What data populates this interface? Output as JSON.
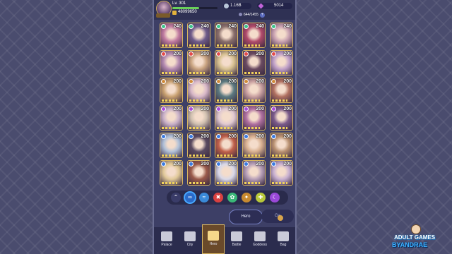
{
  "player": {
    "level": "Lv. 301",
    "power": "48099650",
    "coins": "1.16B",
    "gems": "5014",
    "hero_count": "644/1455"
  },
  "heroes": [
    {
      "level": "240",
      "element": "#3cc38a",
      "tint": "#c07aa0"
    },
    {
      "level": "240",
      "element": "#3cc38a",
      "tint": "#6e5b8a"
    },
    {
      "level": "240",
      "element": "#3cc38a",
      "tint": "#8a6f6b"
    },
    {
      "level": "240",
      "element": "#3cc38a",
      "tint": "#b04a6a"
    },
    {
      "level": "240",
      "element": "#3cc38a",
      "tint": "#c8a0b0"
    },
    {
      "level": "200",
      "element": "#e24a4a",
      "tint": "#b48ab0"
    },
    {
      "level": "200",
      "element": "#e24a4a",
      "tint": "#c9a380"
    },
    {
      "level": "200",
      "element": "#e24a4a",
      "tint": "#d6c090"
    },
    {
      "level": "200",
      "element": "#e24a4a",
      "tint": "#6a4a60"
    },
    {
      "level": "200",
      "element": "#e24a4a",
      "tint": "#c0a0c8"
    },
    {
      "level": "200",
      "element": "#d08a3a",
      "tint": "#c8a070"
    },
    {
      "level": "200",
      "element": "#d08a3a",
      "tint": "#d8b8c8"
    },
    {
      "level": "200",
      "element": "#d08a3a",
      "tint": "#5c7a80"
    },
    {
      "level": "200",
      "element": "#d08a3a",
      "tint": "#c9a0a0"
    },
    {
      "level": "200",
      "element": "#d08a3a",
      "tint": "#b07060"
    },
    {
      "level": "200",
      "element": "#a84ad8",
      "tint": "#c8b0c8"
    },
    {
      "level": "200",
      "element": "#a84ad8",
      "tint": "#d0c0b0"
    },
    {
      "level": "200",
      "element": "#a84ad8",
      "tint": "#e0c8d0"
    },
    {
      "level": "200",
      "element": "#a84ad8",
      "tint": "#b070a0"
    },
    {
      "level": "200",
      "element": "#a84ad8",
      "tint": "#7a5a8a"
    },
    {
      "level": "200",
      "element": "#3a7ae0",
      "tint": "#b0c0d8"
    },
    {
      "level": "200",
      "element": "#3a7ae0",
      "tint": "#5a4a60"
    },
    {
      "level": "200",
      "element": "#3a7ae0",
      "tint": "#c0604a"
    },
    {
      "level": "200",
      "element": "#3a7ae0",
      "tint": "#d8b090"
    },
    {
      "level": "200",
      "element": "#3a7ae0",
      "tint": "#b89070"
    },
    {
      "level": "200",
      "element": "#3a7ae0",
      "tint": "#e0c898"
    },
    {
      "level": "200",
      "element": "#3a7ae0",
      "tint": "#9a5a4a"
    },
    {
      "level": "200",
      "element": "#3a7ae0",
      "tint": "#d8d8e8"
    },
    {
      "level": "200",
      "element": "#3a7ae0",
      "tint": "#b8a0b8"
    },
    {
      "level": "200",
      "element": "#3a7ae0",
      "tint": "#c8b0d0"
    }
  ],
  "filters": [
    {
      "name": "collapse-up-icon",
      "glyph": "⌃",
      "color": "#3a3c68"
    },
    {
      "name": "infinity-filter-icon",
      "glyph": "∞",
      "color": "#2a6ac8"
    },
    {
      "name": "water-filter-icon",
      "glyph": "≈",
      "color": "#3a8ad8"
    },
    {
      "name": "fire-filter-icon",
      "glyph": "✖",
      "color": "#d84040"
    },
    {
      "name": "nature-filter-icon",
      "glyph": "✿",
      "color": "#3ab878"
    },
    {
      "name": "earth-filter-icon",
      "glyph": "✦",
      "color": "#c88a30"
    },
    {
      "name": "light-filter-icon",
      "glyph": "✚",
      "color": "#b8c83a"
    },
    {
      "name": "dark-filter-icon",
      "glyph": "☾",
      "color": "#9a48d8"
    }
  ],
  "tabs": {
    "hero": "Hero",
    "gather": "Ga"
  },
  "nav": [
    {
      "label": "Palace",
      "active": false
    },
    {
      "label": "City",
      "active": false
    },
    {
      "label": "Hero",
      "active": true
    },
    {
      "label": "Battle",
      "active": false
    },
    {
      "label": "Goddess",
      "active": false
    },
    {
      "label": "Bag",
      "active": false
    }
  ],
  "watermark": {
    "line1": "ADULT GAMES",
    "line2": "BYANDRAE"
  }
}
